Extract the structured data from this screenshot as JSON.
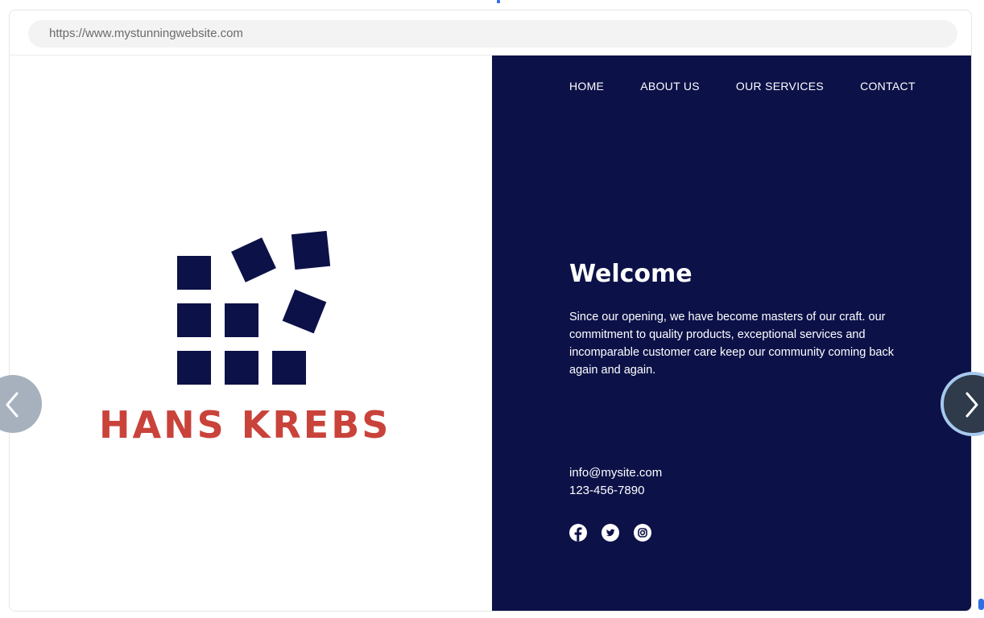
{
  "browser": {
    "url": "https://www.mystunningwebsite.com"
  },
  "brand": {
    "name": "HANS KREBS",
    "name_color": "#c9433b",
    "logo_color": "#0c1148",
    "logo_icon": "scattered-squares-logo"
  },
  "nav": {
    "items": [
      {
        "label": "HOME"
      },
      {
        "label": "ABOUT US"
      },
      {
        "label": "OUR SERVICES"
      },
      {
        "label": "CONTACT"
      }
    ]
  },
  "hero": {
    "title": "Welcome",
    "body": "Since our opening, we have become masters of our craft. our commitment to quality products, exceptional services and incomparable customer care keep our community coming back again and again.",
    "background": "#0c1148"
  },
  "contact": {
    "email": "info@mysite.com",
    "phone": "123-456-7890"
  },
  "social": [
    "facebook-icon",
    "twitter-icon",
    "instagram-icon"
  ],
  "carousel": {
    "prev_icon": "chevron-left-icon",
    "next_icon": "chevron-right-icon"
  }
}
